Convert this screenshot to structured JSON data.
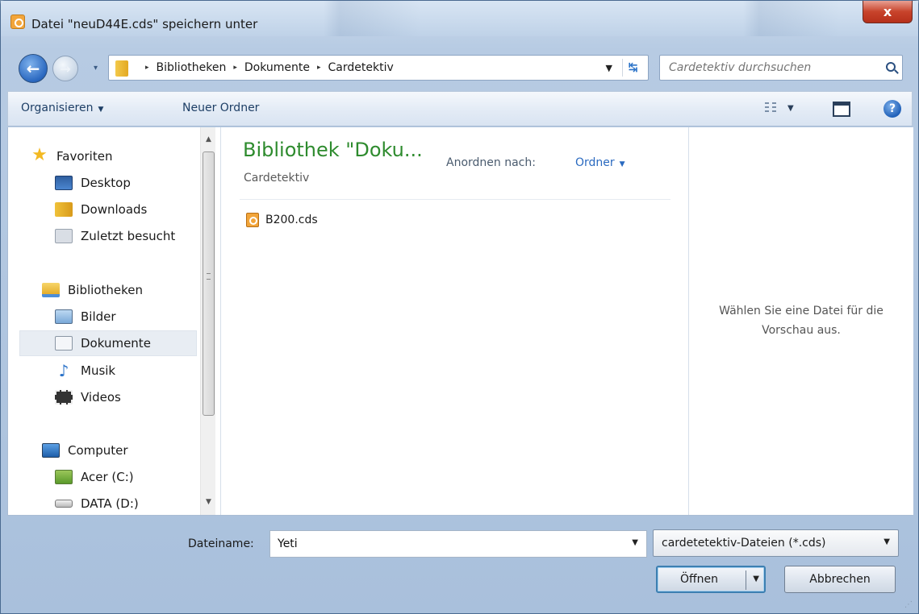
{
  "window": {
    "title": "Datei \"neuD44E.cds\" speichern unter",
    "close_label": "x"
  },
  "nav": {
    "back_arrow": "←",
    "forward_arrow": "→",
    "history_arrow": "▾",
    "breadcrumbs": [
      "Bibliotheken",
      "Dokumente",
      "Cardetektiv"
    ],
    "breadcrumb_sep": "▸",
    "address_dropdown": "▼",
    "refresh_glyph": "↹",
    "search_placeholder": "Cardetektiv durchsuchen"
  },
  "toolbar": {
    "organize_label": "Organisieren",
    "organize_arrow": "▼",
    "new_folder_label": "Neuer Ordner",
    "view_arrow": "▼",
    "help_label": "?"
  },
  "sidebar": {
    "favorites": {
      "label": "Favoriten",
      "icon": "star-icon"
    },
    "favorite_items": [
      {
        "label": "Desktop",
        "icon": "desktop-icon"
      },
      {
        "label": "Downloads",
        "icon": "downloads-icon"
      },
      {
        "label": "Zuletzt besucht",
        "icon": "recent-places-icon"
      }
    ],
    "libraries": {
      "label": "Bibliotheken",
      "icon": "libraries-icon"
    },
    "library_items": [
      {
        "label": "Bilder",
        "icon": "pictures-icon"
      },
      {
        "label": "Dokumente",
        "icon": "documents-icon",
        "selected": true
      },
      {
        "label": "Musik",
        "icon": "music-icon"
      },
      {
        "label": "Videos",
        "icon": "videos-icon"
      }
    ],
    "computer": {
      "label": "Computer",
      "icon": "computer-icon"
    },
    "drives": [
      {
        "label": "Acer (C:)",
        "icon": "drive-c-icon"
      },
      {
        "label": "DATA (D:)",
        "icon": "drive-d-icon"
      }
    ],
    "scroll_up": "▲",
    "scroll_down": "▼"
  },
  "main": {
    "library_title": "Bibliothek \"Doku...",
    "library_subtitle": "Cardetektiv",
    "arrange_label": "Anordnen nach:",
    "arrange_value": "Ordner",
    "arrange_arrow": "▼",
    "files": [
      {
        "name": "B200.cds",
        "icon": "cds-file-icon"
      }
    ]
  },
  "preview": {
    "line1": "Wählen Sie eine Datei für die",
    "line2": "Vorschau aus."
  },
  "bottom": {
    "filename_label": "Dateiname:",
    "filename_value": "Yeti",
    "filename_arrow": "▼",
    "filetype_value": "cardetetektiv-Dateien (*.cds)",
    "filetype_arrow": "▼",
    "open_label": "Öffnen",
    "open_arrow": "▼",
    "cancel_label": "Abbrechen",
    "grip": "⋰"
  },
  "colors": {
    "accent": "#2a6ac0",
    "library_title": "#2e8b2e",
    "close_button": "#c8432b"
  }
}
